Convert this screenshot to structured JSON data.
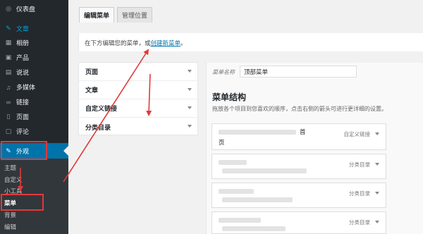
{
  "sidebar": {
    "items": [
      {
        "label": "仪表盘",
        "icon": "dashboard-icon",
        "glyph": "◎"
      },
      {
        "label": "文章",
        "icon": "pin-icon",
        "glyph": "✎"
      },
      {
        "label": "相册",
        "icon": "gallery-icon",
        "glyph": "▦"
      },
      {
        "label": "产品",
        "icon": "cart-icon",
        "glyph": "▣"
      },
      {
        "label": "说说",
        "icon": "comment-icon",
        "glyph": "▤"
      },
      {
        "label": "多媒体",
        "icon": "media-icon",
        "glyph": "♫"
      },
      {
        "label": "链接",
        "icon": "link-icon",
        "glyph": "∞"
      },
      {
        "label": "页面",
        "icon": "page-icon",
        "glyph": "▯"
      },
      {
        "label": "评论",
        "icon": "comments-icon",
        "glyph": "▢"
      },
      {
        "label": "外观",
        "icon": "appearance-icon",
        "glyph": "✎"
      }
    ],
    "submenu": [
      "主题",
      "自定义",
      "小工具",
      "菜单",
      "背景",
      "编辑"
    ]
  },
  "tabs": {
    "edit": "编辑菜单",
    "locations": "管理位置"
  },
  "notice": {
    "text": "在下方编辑您的菜单，或",
    "link": "创建新菜单",
    "end": "。"
  },
  "accordion": [
    {
      "label": "页面"
    },
    {
      "label": "文章"
    },
    {
      "label": "自定义链接"
    },
    {
      "label": "分类目录"
    }
  ],
  "menu_editor": {
    "name_label": "菜单名称",
    "name_value": "顶部菜单",
    "structure_title": "菜单结构",
    "structure_desc": "拖放各个项目到您喜欢的顺序，点击右侧的箭头可进行更详细的设置。",
    "items": [
      {
        "title_a": "首",
        "title_b": "页",
        "type": "自定义链接"
      },
      {
        "title_a": "",
        "title_b": "",
        "type": "分类目录"
      },
      {
        "title_a": "",
        "title_b": "",
        "type": "分类目录"
      },
      {
        "title_a": "",
        "title_b": "",
        "type": "分类目录"
      }
    ]
  },
  "colors": {
    "sidebar_bg": "#23282d",
    "accent": "#0073aa",
    "annotation": "#e03a3a"
  }
}
